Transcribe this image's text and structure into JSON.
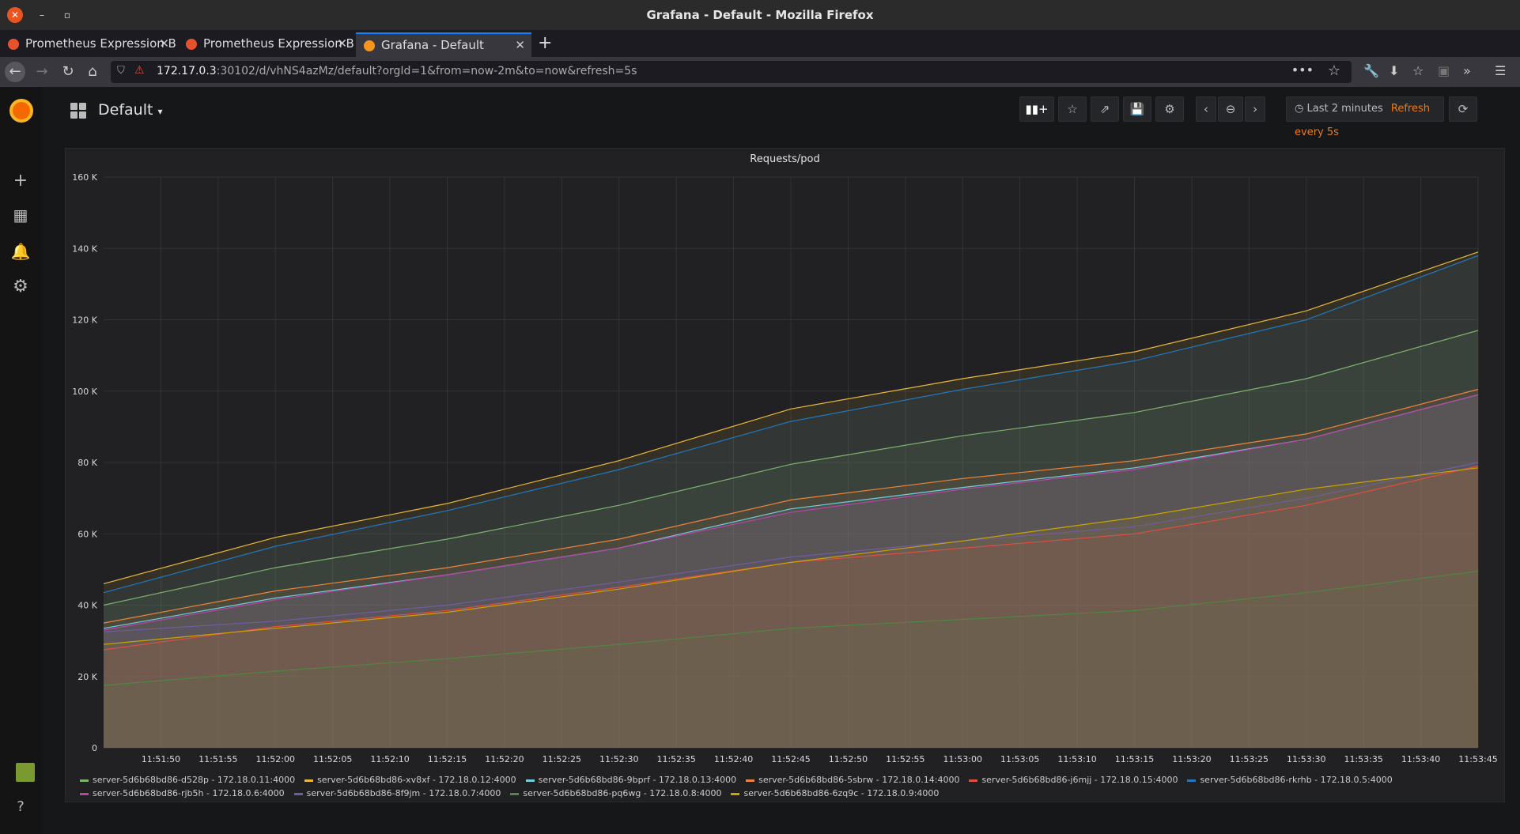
{
  "window": {
    "title": "Grafana - Default - Mozilla Firefox"
  },
  "tabs": [
    {
      "label": "Prometheus Expression B"
    },
    {
      "label": "Prometheus Expression B"
    },
    {
      "label": "Grafana - Default"
    }
  ],
  "navbar": {
    "url_host": "172.17.0.3",
    "url_rest": ":30102/d/vhNS4azMz/default?orgId=1&from=now-2m&to=now&refresh=5s"
  },
  "dashboard": {
    "title": "Default",
    "time_range": "Last 2 minutes",
    "refresh": "Refresh every 5s"
  },
  "panel": {
    "title": "Requests/pod"
  },
  "chart_data": {
    "type": "area",
    "title": "Requests/pod",
    "stacked": false,
    "ylim": [
      0,
      160000
    ],
    "y_ticks": [
      "0",
      "20 K",
      "40 K",
      "60 K",
      "80 K",
      "100 K",
      "120 K",
      "140 K",
      "160 K"
    ],
    "x": [
      "11:51:45",
      "11:52:00",
      "11:52:15",
      "11:52:30",
      "11:52:45",
      "11:53:00",
      "11:53:15",
      "11:53:30",
      "11:53:45"
    ],
    "x_ticks": [
      "11:51:50",
      "11:51:55",
      "11:52:00",
      "11:52:05",
      "11:52:10",
      "11:52:15",
      "11:52:20",
      "11:52:25",
      "11:52:30",
      "11:52:35",
      "11:52:40",
      "11:52:45",
      "11:52:50",
      "11:52:55",
      "11:53:00",
      "11:53:05",
      "11:53:10",
      "11:53:15",
      "11:53:20",
      "11:53:25",
      "11:53:30",
      "11:53:35",
      "11:53:40",
      "11:53:45"
    ],
    "grid": true,
    "legend_position": "bottom",
    "series": [
      {
        "name": "server-5d6b68bd86-d528p - 172.18.0.11:4000",
        "color": "#7eb26d",
        "values": [
          40000,
          50500,
          58500,
          68000,
          79500,
          87500,
          94000,
          103500,
          117000
        ]
      },
      {
        "name": "server-5d6b68bd86-xv8xf - 172.18.0.12:4000",
        "color": "#eab839",
        "values": [
          46000,
          59000,
          68500,
          80500,
          95000,
          103500,
          111000,
          122500,
          139000
        ]
      },
      {
        "name": "server-5d6b68bd86-9bprf - 172.18.0.13:4000",
        "color": "#6ed0e0",
        "values": [
          33500,
          42000,
          48500,
          56000,
          67000,
          73000,
          78500,
          86500,
          99000
        ]
      },
      {
        "name": "server-5d6b68bd86-5sbrw - 172.18.0.14:4000",
        "color": "#ef843c",
        "values": [
          35000,
          44000,
          50500,
          58500,
          69500,
          75500,
          80500,
          88000,
          100500
        ]
      },
      {
        "name": "server-5d6b68bd86-j6mjj - 172.18.0.15:4000",
        "color": "#e24d42",
        "values": [
          27500,
          34000,
          38500,
          45000,
          52000,
          56000,
          60000,
          68000,
          79000
        ]
      },
      {
        "name": "server-5d6b68bd86-rkrhb - 172.18.0.5:4000",
        "color": "#1f78c1",
        "values": [
          43500,
          56500,
          66500,
          78000,
          91500,
          100500,
          108500,
          120000,
          138000
        ]
      },
      {
        "name": "server-5d6b68bd86-rjb5h - 172.18.0.6:4000",
        "color": "#ba43a9",
        "values": [
          33000,
          41500,
          48500,
          56000,
          66000,
          72500,
          78000,
          86500,
          99000
        ]
      },
      {
        "name": "server-5d6b68bd86-8f9jm - 172.18.0.7:4000",
        "color": "#705da0",
        "values": [
          32500,
          35500,
          40000,
          46500,
          53500,
          58000,
          62000,
          70000,
          80000
        ]
      },
      {
        "name": "server-5d6b68bd86-pq6wg - 172.18.0.8:4000",
        "color": "#508642",
        "values": [
          17500,
          21500,
          25000,
          29000,
          33500,
          36000,
          38500,
          43500,
          49500
        ]
      },
      {
        "name": "server-5d6b68bd86-6zq9c - 172.18.0.9:4000",
        "color": "#cca300",
        "values": [
          29000,
          33500,
          38000,
          44500,
          52000,
          58000,
          64500,
          72500,
          78500
        ]
      }
    ]
  }
}
